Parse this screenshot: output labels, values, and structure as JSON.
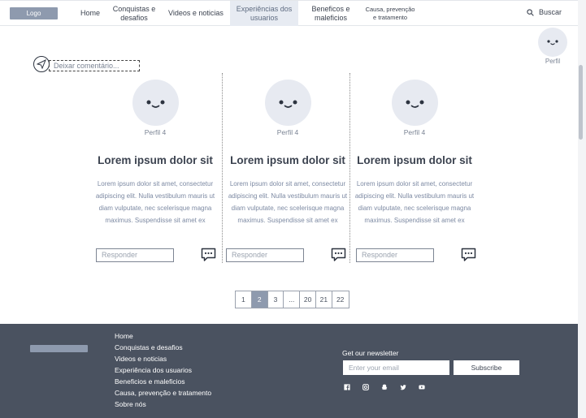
{
  "header": {
    "logo": "Logo",
    "nav": [
      "Home",
      "Conquistas e desafios",
      "Videos e noticias",
      "Experiências dos usuarios",
      "Beneficos e maleficios",
      "Causa, prevenção e tratamento"
    ],
    "search_label": "Buscar"
  },
  "profile": {
    "label": "Perfil"
  },
  "comment": {
    "placeholder": "Deixar comentário..."
  },
  "cards": [
    {
      "author": "Perfil 4",
      "title": "Lorem ipsum dolor sit",
      "body": "Lorem ipsum dolor sit amet, consectetur adipiscing elit. Nulla vestibulum mauris ut diam vulputate, nec scelerisque magna maximus. Suspendisse sit amet ex",
      "reply_placeholder": "Responder"
    },
    {
      "author": "Perfil 4",
      "title": "Lorem ipsum dolor sit",
      "body": "Lorem ipsum dolor sit amet, consectetur adipiscing elit. Nulla vestibulum mauris ut diam vulputate, nec scelerisque magna maximus. Suspendisse sit amet ex",
      "reply_placeholder": "Responder"
    },
    {
      "author": "Perfil 4",
      "title": "Lorem ipsum dolor sit",
      "body": "Lorem ipsum dolor sit amet, consectetur adipiscing elit. Nulla vestibulum mauris ut diam vulputate, nec scelerisque magna maximus. Suspendisse sit amet ex",
      "reply_placeholder": "Responder"
    }
  ],
  "pagination": [
    "1",
    "2",
    "3",
    "...",
    "20",
    "21",
    "22"
  ],
  "pagination_active": "2",
  "footer": {
    "links": [
      "Home",
      "Conquistas e desafios",
      "Videos e noticias",
      "Experiência dos usuarios",
      "Beneficios e maleficios",
      "Causa, prevenção e tratamento",
      "Sobre nós"
    ],
    "newsletter_title": "Get our newsletter",
    "email_placeholder": "Enter your email",
    "subscribe_label": "Subscribe",
    "social_icons": [
      "facebook-icon",
      "instagram-icon",
      "snapchat-icon",
      "twitter-icon",
      "youtube-icon"
    ]
  },
  "colors": {
    "accent": "#8e9aae",
    "footer_bg": "#4a5260",
    "active_nav_bg": "#e7ebf2"
  }
}
